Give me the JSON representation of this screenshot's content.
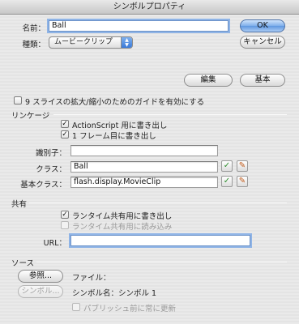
{
  "window": {
    "title": "シンボルプロパティ"
  },
  "name_field": {
    "label": "名前：",
    "value": "Ball"
  },
  "type_select": {
    "label": "種類：",
    "value": "ムービークリップ"
  },
  "buttons": {
    "ok": "OK",
    "cancel": "キャンセル",
    "edit": "編集",
    "basic": "基本"
  },
  "scale9": {
    "label": "9 スライスの拡大/縮小のためのガイドを有効にする",
    "checked": false
  },
  "linkage": {
    "header": "リンケージ",
    "export_actionscript": {
      "label": "ActionScript 用に書き出し",
      "checked": true
    },
    "export_first_frame": {
      "label": "1 フレーム目に書き出し",
      "checked": true
    },
    "identifier": {
      "label": "識別子：",
      "value": ""
    },
    "class": {
      "label": "クラス：",
      "value": "Ball"
    },
    "base_class": {
      "label": "基本クラス：",
      "value": "flash.display.MovieClip"
    }
  },
  "sharing": {
    "header": "共有",
    "export_runtime": {
      "label": "ランタイム共有用に書き出し",
      "checked": true
    },
    "import_runtime": {
      "label": "ランタイム共有用に読み込み",
      "checked": false,
      "enabled": false
    },
    "url": {
      "label": "URL：",
      "value": ""
    }
  },
  "source": {
    "header": "ソース",
    "browse_button": "参照...",
    "symbol_button": "シンボル...",
    "file_text": "ファイル：",
    "symbol_name_text": "シンボル名：シンボル 1",
    "always_update": {
      "label": "パブリッシュ前に常に更新",
      "checked": false,
      "enabled": false
    }
  },
  "icons": {
    "validate": "check-icon",
    "edit": "pencil-icon"
  }
}
